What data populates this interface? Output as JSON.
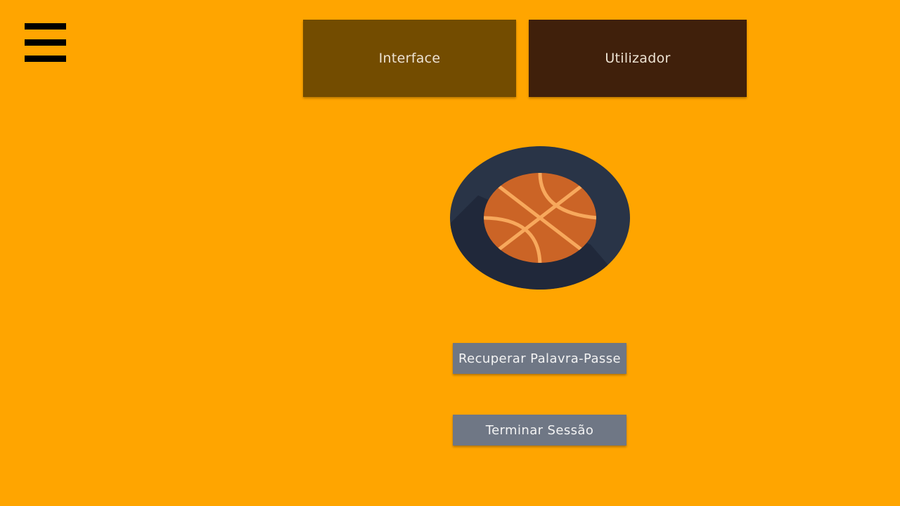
{
  "app": {
    "background_color": "#FFA500"
  },
  "menu": {
    "icon": "hamburger-menu-icon"
  },
  "tabs": [
    {
      "label": "Interface",
      "color": "#734C00"
    },
    {
      "label": "Utilizador",
      "color": "#40200B"
    }
  ],
  "logo": {
    "icon": "basketball-icon"
  },
  "actions": {
    "recover_password_label": "Recuperar Palavra-Passe",
    "logout_label": "Terminar Sessão",
    "button_color": "#6F7785"
  }
}
